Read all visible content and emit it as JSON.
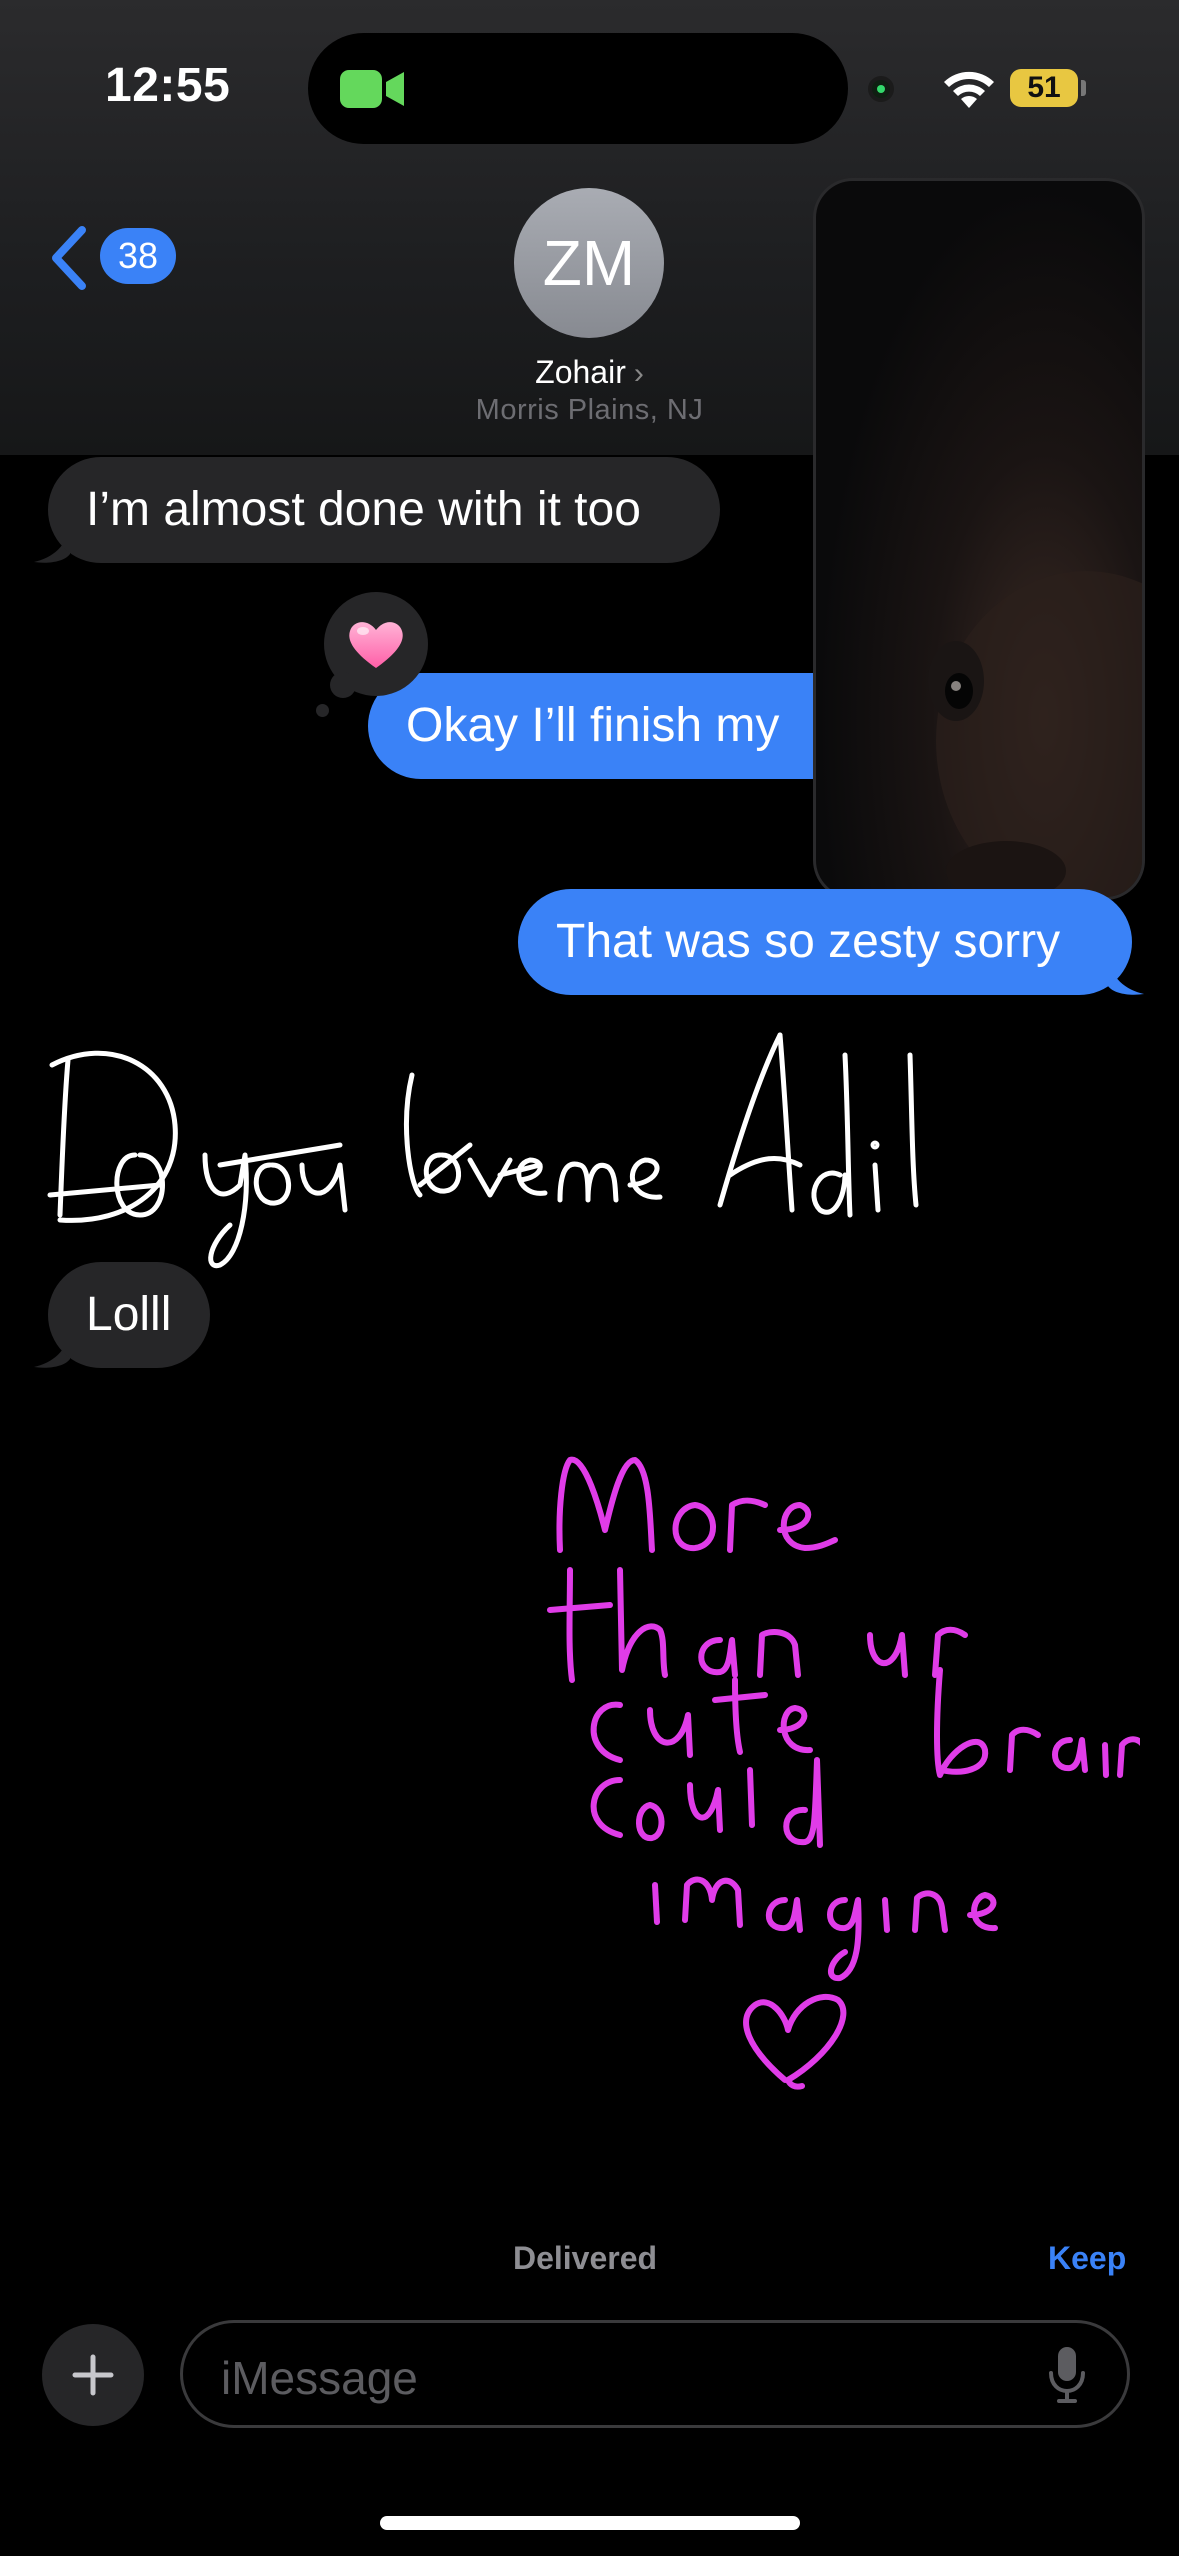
{
  "status_bar": {
    "time": "12:55",
    "battery": "51",
    "active_call": "facetime",
    "accent_green": "#64d85c"
  },
  "header": {
    "back_count": "38",
    "avatar_initials": "ZM",
    "contact_name": "Zohair",
    "contact_location": "Morris Plains, NJ"
  },
  "messages": [
    {
      "direction": "incoming",
      "text": "I’m almost done with it too"
    },
    {
      "direction": "outgoing",
      "text": "Okay I’ll finish my",
      "tapback": "pink-heart"
    },
    {
      "direction": "outgoing",
      "text": "That was so zesty sorry"
    },
    {
      "direction": "incoming",
      "type": "handwriting",
      "text": "Do you love me Adil",
      "color": "#ffffff"
    },
    {
      "direction": "incoming",
      "text": "Lolll"
    },
    {
      "direction": "outgoing",
      "type": "handwriting",
      "text": "More than ur cute brain could imagine",
      "color": "#e03ce8",
      "heart": true
    }
  ],
  "footer": {
    "delivered_label": "Delivered",
    "keep_label": "Keep",
    "input_placeholder": "iMessage"
  },
  "colors": {
    "outgoing_bubble": "#3a82f7",
    "incoming_bubble": "#262628",
    "accent": "#3a82f7"
  }
}
